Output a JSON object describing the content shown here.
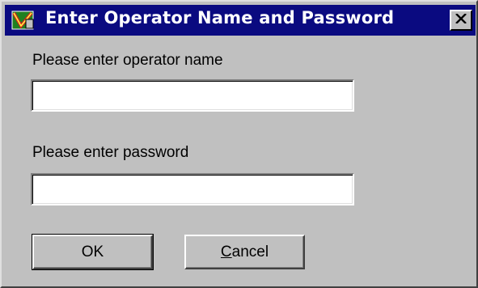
{
  "window": {
    "title": "Enter Operator Name and Password",
    "icon": "app-icon",
    "close_icon": "close-icon",
    "titlebar_color": "#0a0a80",
    "background_color": "#c0c0c0"
  },
  "form": {
    "operator_label": "Please enter operator name",
    "operator_value": "",
    "password_label": "Please enter password",
    "password_value": ""
  },
  "buttons": {
    "ok_label": "OK",
    "cancel_label_underlined": "C",
    "cancel_label_rest": "ancel"
  }
}
